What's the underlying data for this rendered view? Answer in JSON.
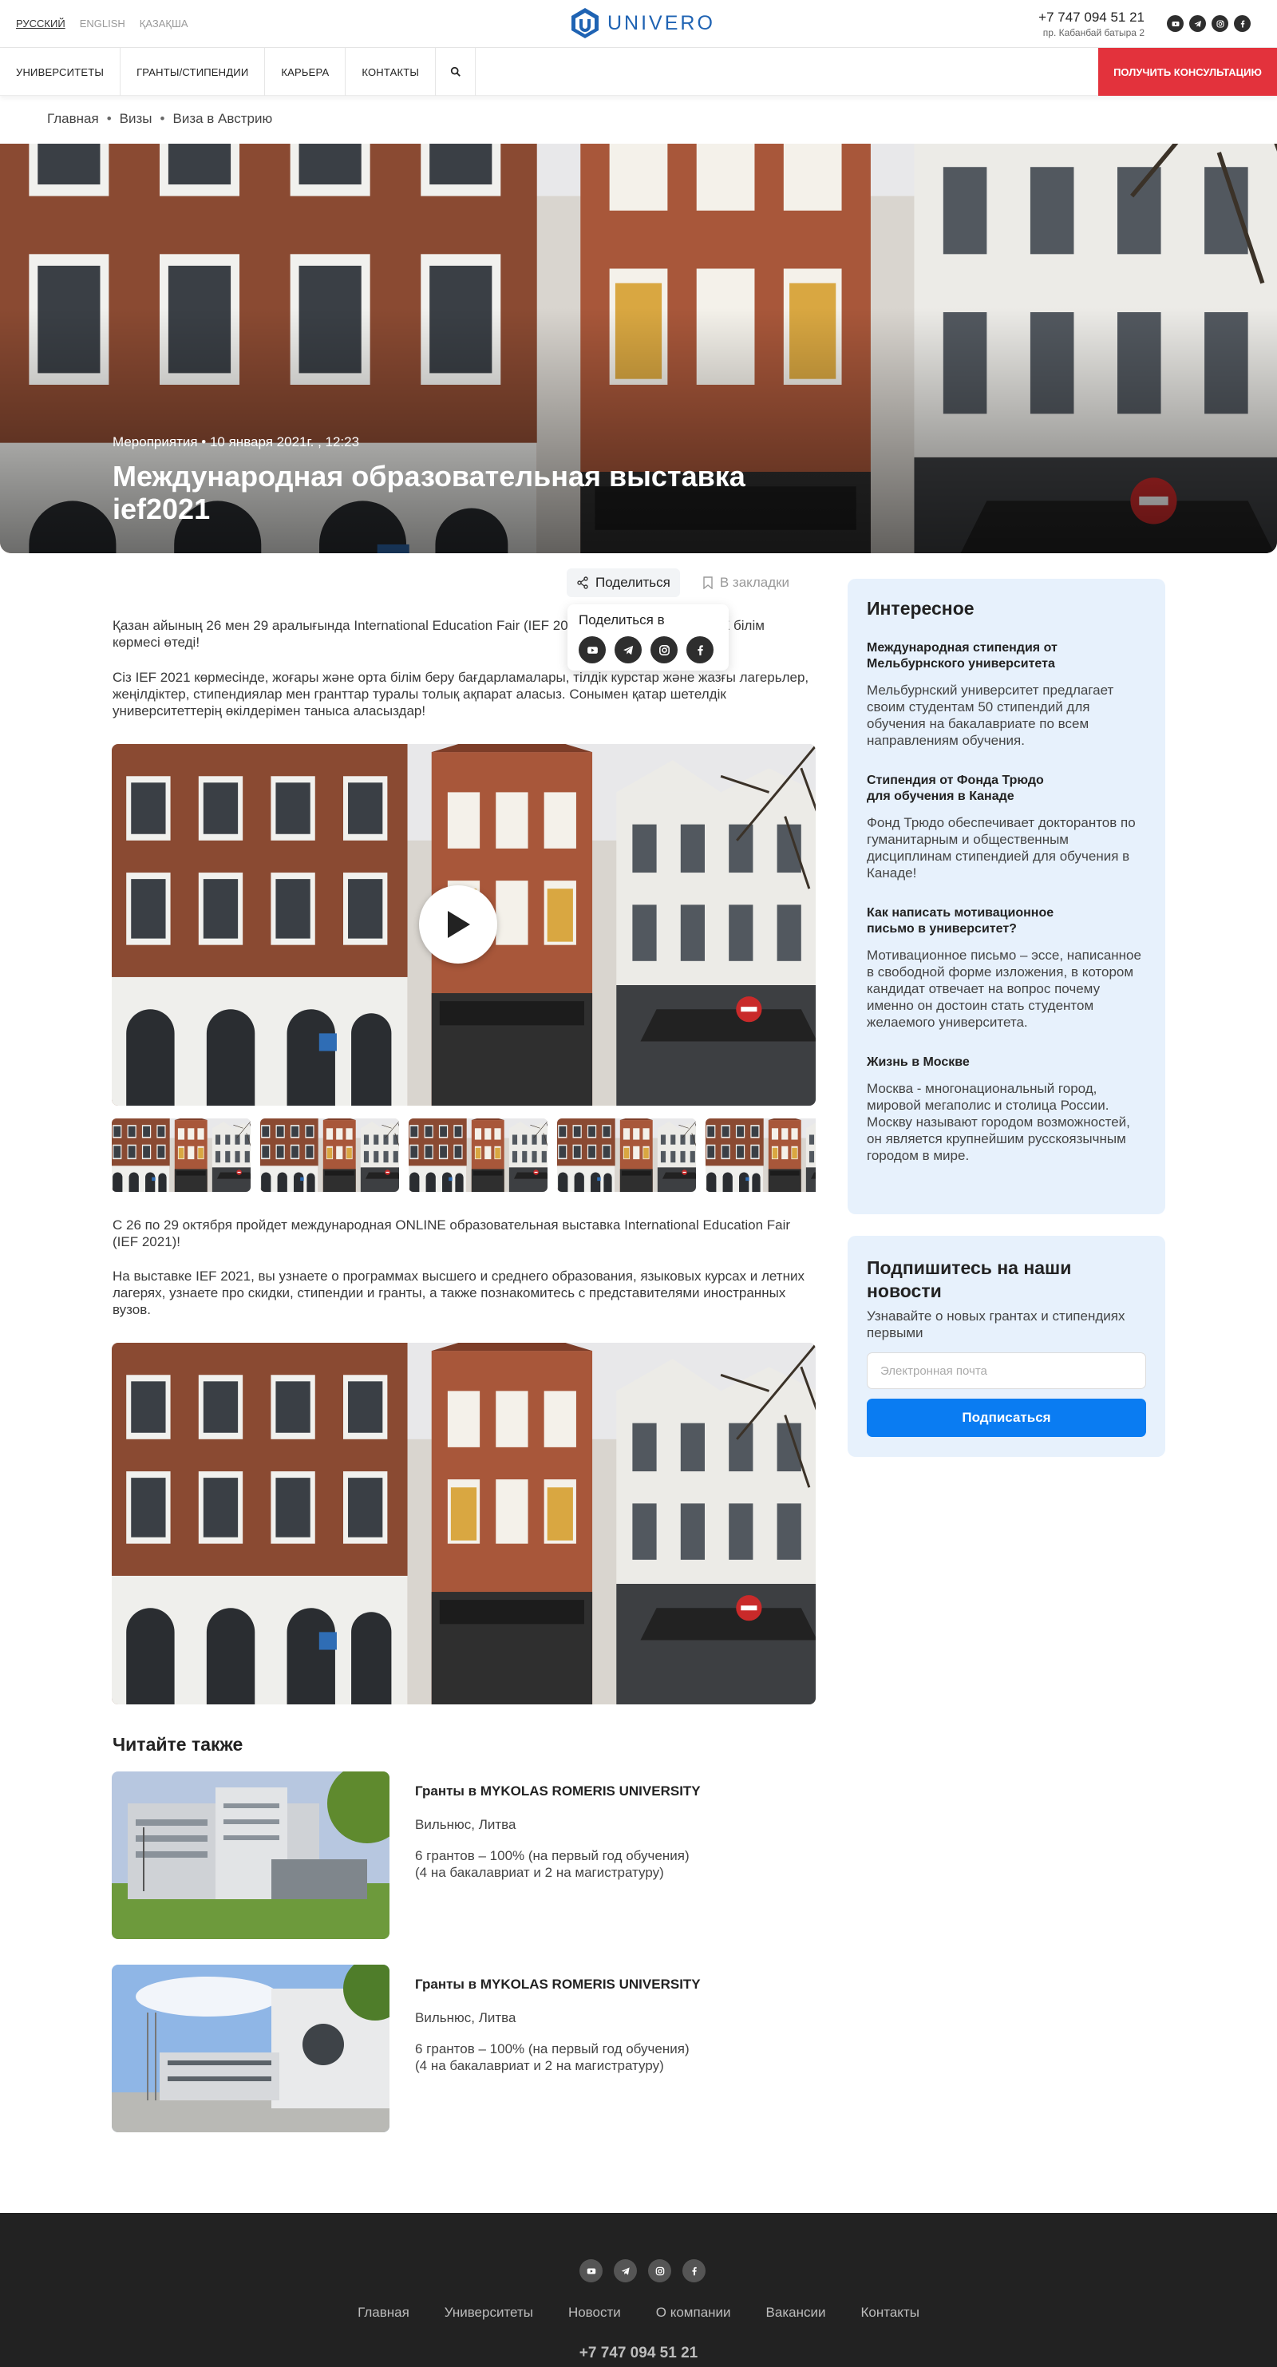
{
  "header": {
    "languages": [
      "РУССКИЙ",
      "ENGLISH",
      "ҚАЗАҚША"
    ],
    "logo_text": "UNIVERO",
    "phone": "+7 747 094 51 21",
    "address": "пр. Кабанбай батыра 2",
    "socials": [
      "youtube-icon",
      "telegram-icon",
      "instagram-icon",
      "facebook-icon"
    ]
  },
  "nav": {
    "items": [
      "УНИВЕРСИТЕТЫ",
      "ГРАНТЫ/СТИПЕНДИИ",
      "КАРЬЕРА",
      "КОНТАКТЫ"
    ],
    "search_icon": "search-icon",
    "cta_label": "ПОЛУЧИТЬ КОНСУЛЬТАЦИЮ"
  },
  "breadcrumb": [
    "Главная",
    "Визы",
    "Виза в Австрию"
  ],
  "hero": {
    "meta": "Мероприятия • 10 января 2021г. , 12:23",
    "title": "Международная образовательная выставка ief2021"
  },
  "actions": {
    "share_label": "Поделиться",
    "bookmark_label": "В закладки",
    "share_popup_title": "Поделиться в"
  },
  "article": {
    "p1": "Қазан айының 26 мен 29 аралығында International Education Fair (IEF 2021) халықаралық ONLINE білім көрмесі өтеді!",
    "p2": "Сіз IEF 2021 көрмесінде, жоғары және орта білім беру бағдарламалары, тілдік курстар және жазғы лагерьлер, жеңілдіктер, стипендиялар мен гранттар туралы толық ақпарат аласыз. Сонымен қатар шетелдік университеттерің өкілдерімен таныса аласыздар!",
    "p3": "С 26 по 29 октября пройдет международная ONLINE образовательная выставка International Education Fair (IEF 2021)!",
    "p4": "На выставке IEF 2021, вы узнаете о программах высшего и среднего образования, языковых курсах и летних лагерях, узнаете про скидки, стипендии и гранты, а также познакомитесь с представителями иностранных вузов."
  },
  "related": {
    "heading": "Читайте также",
    "items": [
      {
        "title": "Гранты в MYKOLAS ROMERIS UNIVERSITY",
        "city": "Вильнюс, Литва",
        "grants_line1": "6 грантов – 100% (на первый год обучения)",
        "grants_line2": "(4 на бакалавриат и 2 на магистратуру)"
      },
      {
        "title": "Гранты в MYKOLAS ROMERIS UNIVERSITY",
        "city": "Вильнюс, Литва",
        "grants_line1": "6 грантов – 100% (на первый год обучения)",
        "grants_line2": "(4 на бакалавриат и 2 на магистратуру)"
      }
    ]
  },
  "sidebar": {
    "heading": "Интересное",
    "items": [
      {
        "title": "Международная стипендия от Мельбурнского университета",
        "desc": "Мельбурнский университет предлагает своим студентам 50 стипендий для обучения на бакалавриате по всем направлениям обучения."
      },
      {
        "title": "Стипендия от Фонда Трюдо для обучения в Канаде",
        "desc": "Фонд Трюдо обеспечивает докторантов по гуманитарным и общественным дисциплинам стипендией для обучения в Канаде!"
      },
      {
        "title": "Как написать мотивационное письмо в университет?",
        "desc": "Мотивационное письмо – эссе, написанное в свободной форме изложения, в котором кандидат отвечает на вопрос почему именно он достоин стать студентом желаемого университета."
      },
      {
        "title": "Жизнь в Москве",
        "desc": "Москва - многонациональный город, мировой мегаполис и столица России. Москву называют городом возможностей, он является крупнейшим русскоязычным городом в мире."
      }
    ]
  },
  "subscribe": {
    "heading": "Подпишитесь на наши новости",
    "desc": "Узнавайте о новых грантах и стипендиях первыми",
    "placeholder": "Электронная почта",
    "button": "Подписаться"
  },
  "footer": {
    "links": [
      "Главная",
      "Университеты",
      "Новости",
      "О компании",
      "Вакансии",
      "Контакты"
    ],
    "phone": "+7 747 094 51 21"
  },
  "colors": {
    "accent_red": "#e3323c",
    "accent_blue": "#0a7cf2",
    "sidebar_bg": "#e7f1fc",
    "footer_bg": "#222222"
  }
}
